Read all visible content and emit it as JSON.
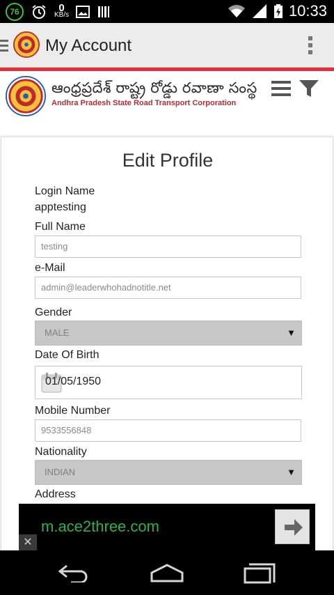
{
  "status_bar": {
    "badge": "76",
    "kbs_value": "0",
    "kbs_unit": "KB/s",
    "time": "10:33"
  },
  "app_bar": {
    "title": "My Account"
  },
  "header": {
    "brand_telugu": "ఆంధ్రప్రదేశ్ రాష్ట్ర రోడ్డు రవాణా సంస్థ",
    "brand_english": "Andhra Pradesh State Road Transport Corporation"
  },
  "form": {
    "title": "Edit Profile",
    "login_name_label": "Login Name",
    "login_name_value": "apptesting",
    "full_name_label": "Full Name",
    "full_name_value": "testing",
    "email_label": "e-Mail",
    "email_value": "admin@leaderwhohadnotitle.net",
    "gender_label": "Gender",
    "gender_value": "MALE",
    "dob_label": "Date Of Birth",
    "dob_value": "01/05/1950",
    "mobile_label": "Mobile Number",
    "mobile_value": "9533556848",
    "nationality_label": "Nationality",
    "nationality_value": "INDIAN",
    "address_label": "Address"
  },
  "ad": {
    "text": "m.ace2three.com",
    "close": "✕"
  },
  "colors": {
    "accent_red": "#e0303a",
    "ad_green": "#29b34a",
    "brand_red": "#c0282d"
  }
}
